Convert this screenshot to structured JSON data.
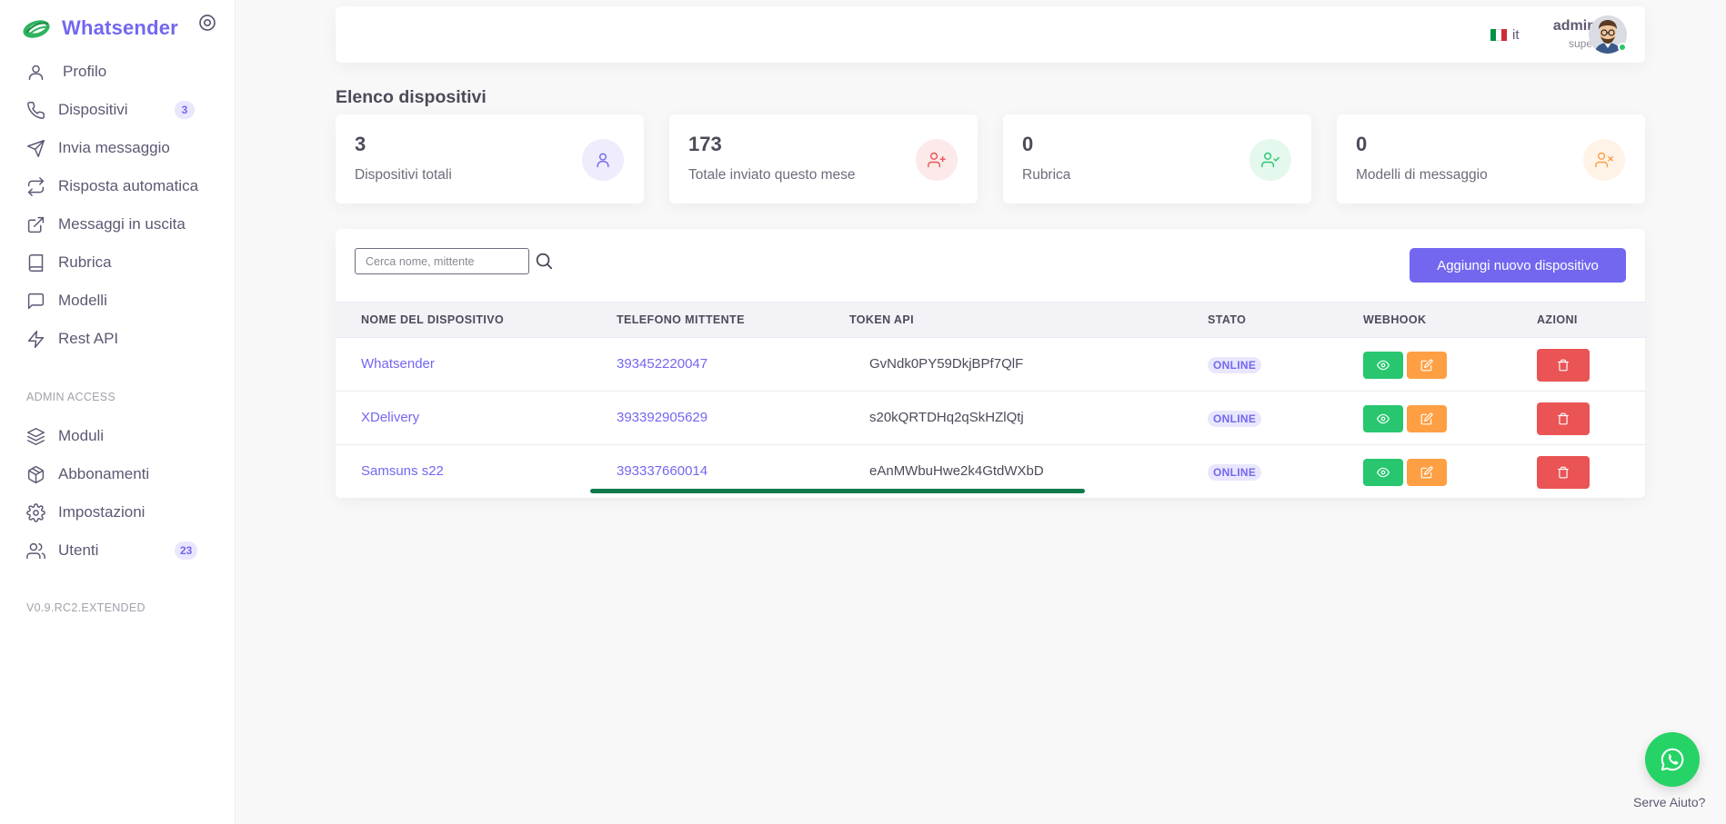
{
  "brand": {
    "name": "Whatsender"
  },
  "nav": {
    "items": [
      {
        "label": "Profilo",
        "icon": "user-icon"
      },
      {
        "label": "Dispositivi",
        "icon": "phone-icon",
        "badge": "3"
      },
      {
        "label": "Invia messaggio",
        "icon": "send-icon"
      },
      {
        "label": "Risposta automatica",
        "icon": "repeat-icon"
      },
      {
        "label": "Messaggi in uscita",
        "icon": "external-link-icon"
      },
      {
        "label": "Rubrica",
        "icon": "book-icon"
      },
      {
        "label": "Modelli",
        "icon": "message-square-icon"
      },
      {
        "label": "Rest API",
        "icon": "zap-icon"
      }
    ],
    "admin_section": "ADMIN ACCESS",
    "admin_items": [
      {
        "label": "Moduli",
        "icon": "layers-icon"
      },
      {
        "label": "Abbonamenti",
        "icon": "package-icon"
      },
      {
        "label": "Impostazioni",
        "icon": "settings-icon"
      },
      {
        "label": "Utenti",
        "icon": "users-icon",
        "badge": "23"
      }
    ],
    "version": "V0.9.RC2.EXTENDED"
  },
  "header": {
    "language": "it",
    "user_name": "admin",
    "user_role": "super"
  },
  "page_title": "Elenco dispositivi",
  "stats": [
    {
      "value": "3",
      "label": "Dispositivi totali",
      "icon": "user-icon",
      "color": "#7367f0",
      "bg": "#eeecfd"
    },
    {
      "value": "173",
      "label": "Totale inviato questo mese",
      "icon": "user-plus-icon",
      "color": "#ea5455",
      "bg": "#fce9e9"
    },
    {
      "value": "0",
      "label": "Rubrica",
      "icon": "user-check-icon",
      "color": "#28c76f",
      "bg": "#e5f8ed"
    },
    {
      "value": "0",
      "label": "Modelli di messaggio",
      "icon": "user-x-icon",
      "color": "#ff9f43",
      "bg": "#fff3e8"
    }
  ],
  "table": {
    "search_placeholder": "Cerca nome, mittente",
    "add_button": "Aggiungi nuovo dispositivo",
    "columns": [
      "NOME DEL DISPOSITIVO",
      "TELEFONO MITTENTE",
      "TOKEN API",
      "STATO",
      "WEBHOOK",
      "AZIONI"
    ],
    "rows": [
      {
        "name": "Whatsender",
        "phone": "393452220047",
        "token": "GvNdk0PY59DkjBPf7QlF",
        "status": "ONLINE"
      },
      {
        "name": "XDelivery",
        "phone": "393392905629",
        "token": "s20kQRTDHq2qSkHZlQtj",
        "status": "ONLINE"
      },
      {
        "name": "Samsuns s22",
        "phone": "393337660014",
        "token": "eAnMWbuHwe2k4GtdWXbD",
        "status": "ONLINE"
      }
    ]
  },
  "help": {
    "label": "Serve Aiuto?"
  },
  "colors": {
    "primary": "#7367f0",
    "success": "#28c76f",
    "warning": "#ff9f43",
    "danger": "#ea5455",
    "whatsapp": "#25d366"
  }
}
